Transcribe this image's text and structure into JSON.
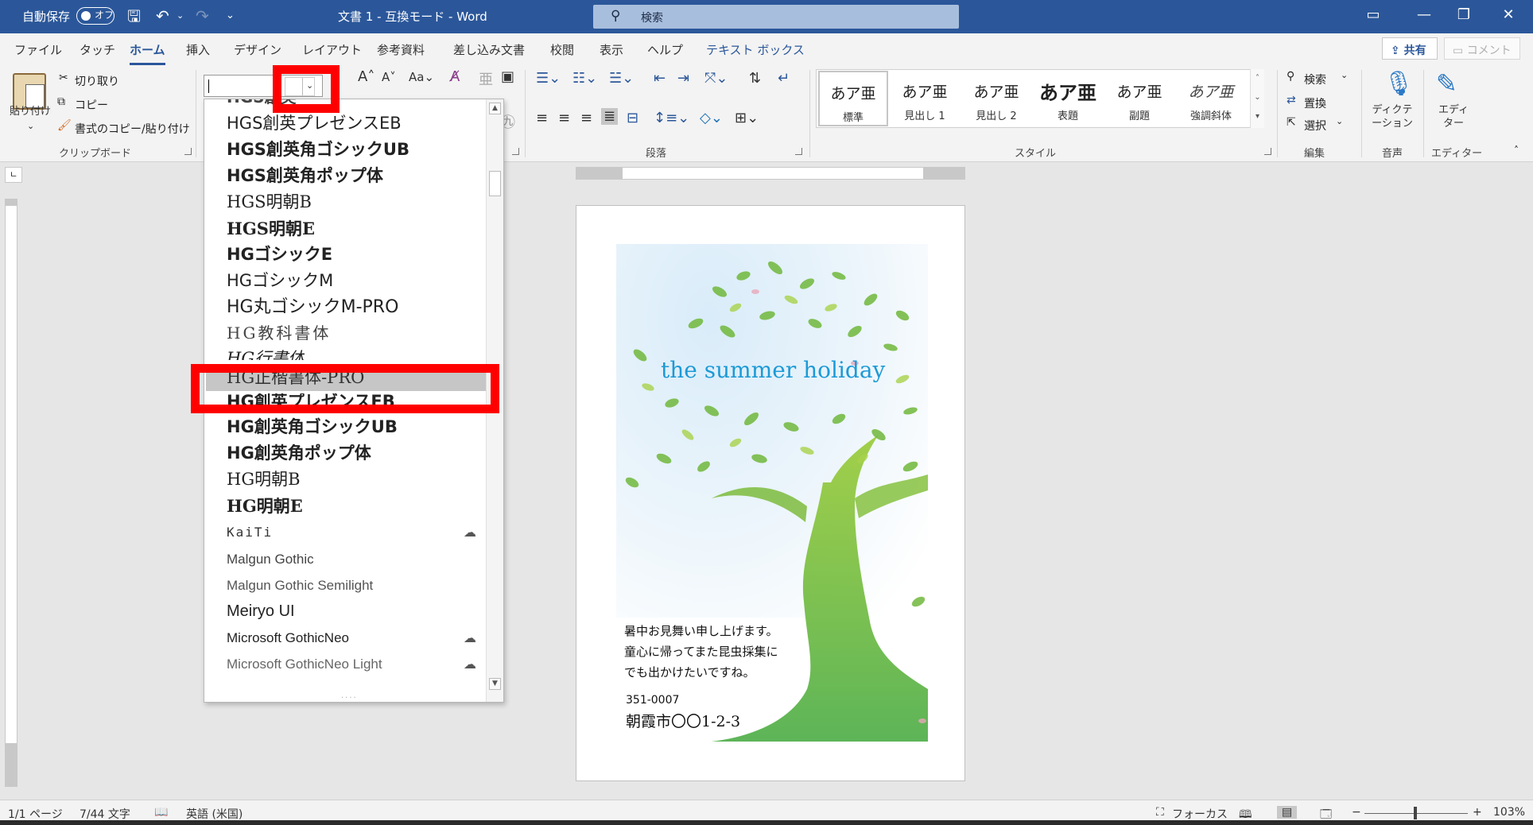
{
  "titlebar": {
    "autosave_label": "自動保存",
    "autosave_state": "オフ",
    "doc_title": "文書 1  -  互換モード  -  Word",
    "search_placeholder": "検索"
  },
  "tabs": [
    "ファイル",
    "タッチ",
    "ホーム",
    "挿入",
    "デザイン",
    "レイアウト",
    "参考資料",
    "差し込み文書",
    "校閲",
    "表示",
    "ヘルプ",
    "テキスト ボックス"
  ],
  "share_label": "共有",
  "comment_label": "コメント",
  "clipboard": {
    "paste_label": "貼り付け",
    "cut_label": "切り取り",
    "copy_label": "コピー",
    "format_painter_label": "書式のコピー/貼り付け",
    "group_label": "クリップボード"
  },
  "paragraph_group_label": "段落",
  "styles": {
    "group_label": "スタイル",
    "items": [
      {
        "sample": "あア亜",
        "name": "標準"
      },
      {
        "sample": "あア亜",
        "name": "見出し 1"
      },
      {
        "sample": "あア亜",
        "name": "見出し 2"
      },
      {
        "sample": "あア亜",
        "name": "表題"
      },
      {
        "sample": "あア亜",
        "name": "副題"
      },
      {
        "sample": "あア亜",
        "name": "強調斜体"
      }
    ]
  },
  "editing": {
    "find_label": "検索",
    "replace_label": "置換",
    "select_label": "選択",
    "group_label": "編集"
  },
  "voice": {
    "dictate_label": "ディクテーション",
    "group_label": "音声"
  },
  "editor": {
    "label": "エディター",
    "group_label": "エディター"
  },
  "font_list": {
    "items": [
      {
        "name": "HGS創英プレゼンスEB",
        "cloud": false
      },
      {
        "name": "HGS創英角ゴシックUB",
        "cloud": false
      },
      {
        "name": "HGS創英角ポップ体",
        "cloud": false
      },
      {
        "name": "HGS明朝B",
        "cloud": false
      },
      {
        "name": "HGS明朝E",
        "cloud": false
      },
      {
        "name": "HGゴシックE",
        "cloud": false
      },
      {
        "name": "HGゴシックM",
        "cloud": false
      },
      {
        "name": "HG丸ゴシックM-PRO",
        "cloud": false
      },
      {
        "name": "HG教科書体",
        "cloud": false
      },
      {
        "name": "HG行書体",
        "cloud": false
      },
      {
        "name": "HG正楷書体-PRO",
        "cloud": false
      },
      {
        "name": "HG創英プレゼンスEB",
        "cloud": false
      },
      {
        "name": "HG創英角ゴシックUB",
        "cloud": false
      },
      {
        "name": "HG創英角ポップ体",
        "cloud": false
      },
      {
        "name": "HG明朝B",
        "cloud": false
      },
      {
        "name": "HG明朝E",
        "cloud": false
      },
      {
        "name": "KaiTi",
        "cloud": true
      },
      {
        "name": "Malgun Gothic",
        "cloud": false
      },
      {
        "name": "Malgun Gothic Semilight",
        "cloud": false
      },
      {
        "name": "Meiryo UI",
        "cloud": false
      },
      {
        "name": "Microsoft GothicNeo",
        "cloud": true
      },
      {
        "name": "Microsoft GothicNeo Light",
        "cloud": true
      }
    ],
    "selected": "HG正楷書体-PRO"
  },
  "card": {
    "title": "the summer holiday",
    "line1": "暑中お見舞い申し上げます。",
    "line2": "童心に帰ってまた昆虫採集に",
    "line3": "でも出かけたいですね。",
    "postal": "351-0007",
    "address": "朝霞市〇〇1-2-3"
  },
  "status": {
    "page": "1/1 ページ",
    "words": "7/44 文字",
    "language": "英語 (米国)",
    "focus": "フォーカス",
    "zoom_minus": "−",
    "zoom_plus": "+",
    "zoom": "103%"
  },
  "colors": {
    "accent": "#2b579a",
    "highlight": "#ff0000",
    "card_title": "#1c9ad6"
  }
}
